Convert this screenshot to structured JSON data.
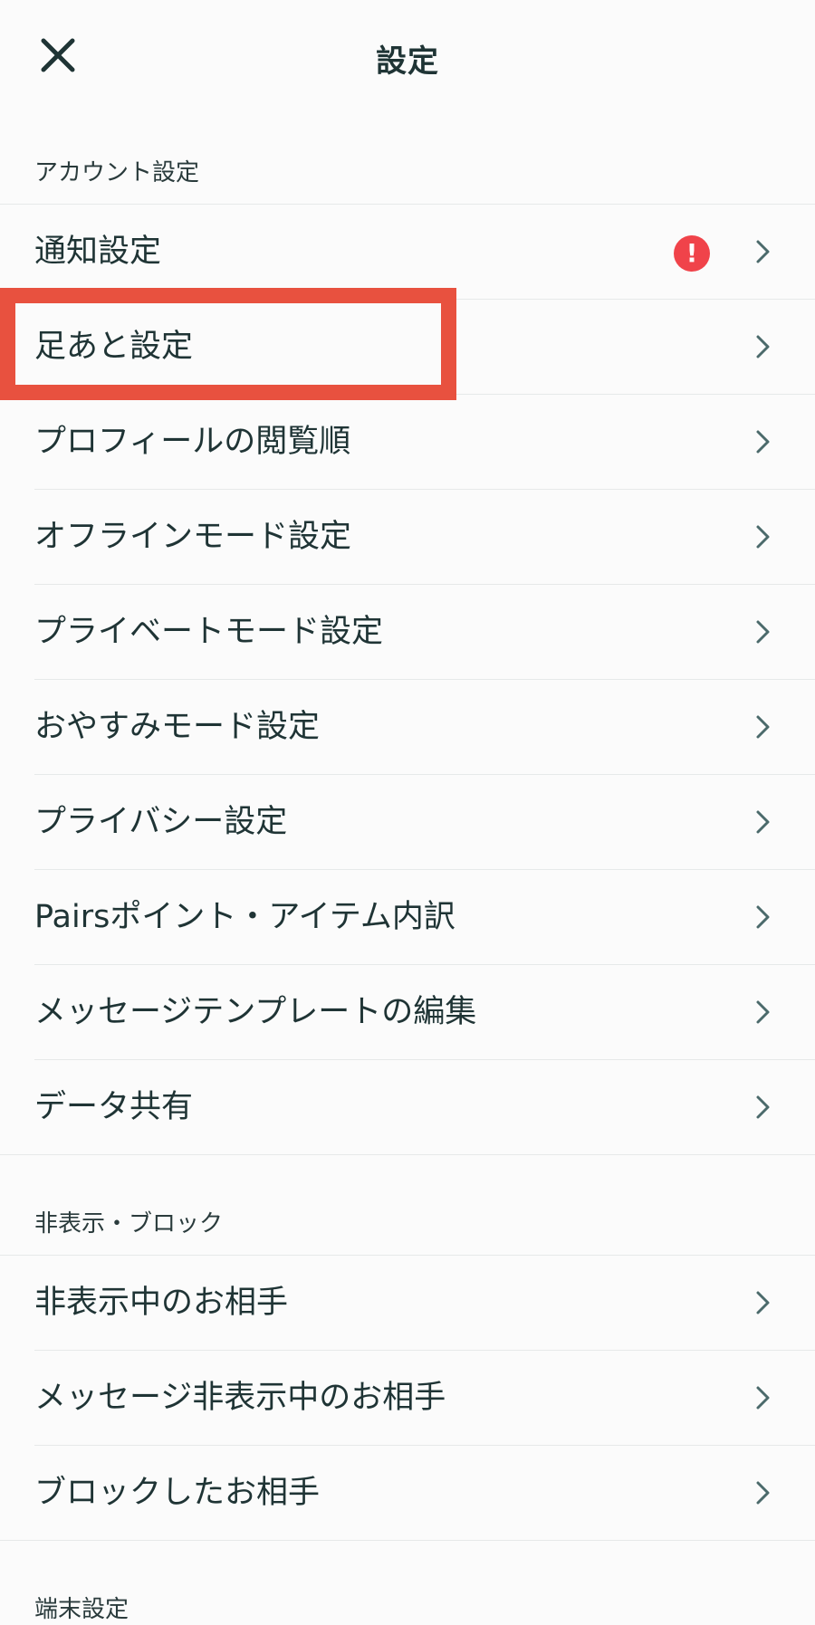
{
  "header": {
    "title": "設定",
    "close_icon": "close-icon"
  },
  "sections": {
    "account": {
      "title": "アカウント設定",
      "items": [
        {
          "label": "通知設定",
          "badge": "!"
        },
        {
          "label": "足あと設定"
        },
        {
          "label": "プロフィールの閲覧順"
        },
        {
          "label": "オフラインモード設定"
        },
        {
          "label": "プライベートモード設定"
        },
        {
          "label": "おやすみモード設定"
        },
        {
          "label": "プライバシー設定"
        },
        {
          "label": "Pairsポイント・アイテム内訳"
        },
        {
          "label": "メッセージテンプレートの編集"
        },
        {
          "label": "データ共有"
        }
      ]
    },
    "hide_block": {
      "title": "非表示・ブロック",
      "items": [
        {
          "label": "非表示中のお相手"
        },
        {
          "label": "メッセージ非表示中のお相手"
        },
        {
          "label": "ブロックしたお相手"
        }
      ]
    },
    "device": {
      "title": "端末設定"
    }
  },
  "colors": {
    "text": "#1f3435",
    "alert": "#f0434a",
    "highlight": "#e8513f",
    "chevron": "#4b6a6b",
    "divider": "#e6e9e9"
  }
}
